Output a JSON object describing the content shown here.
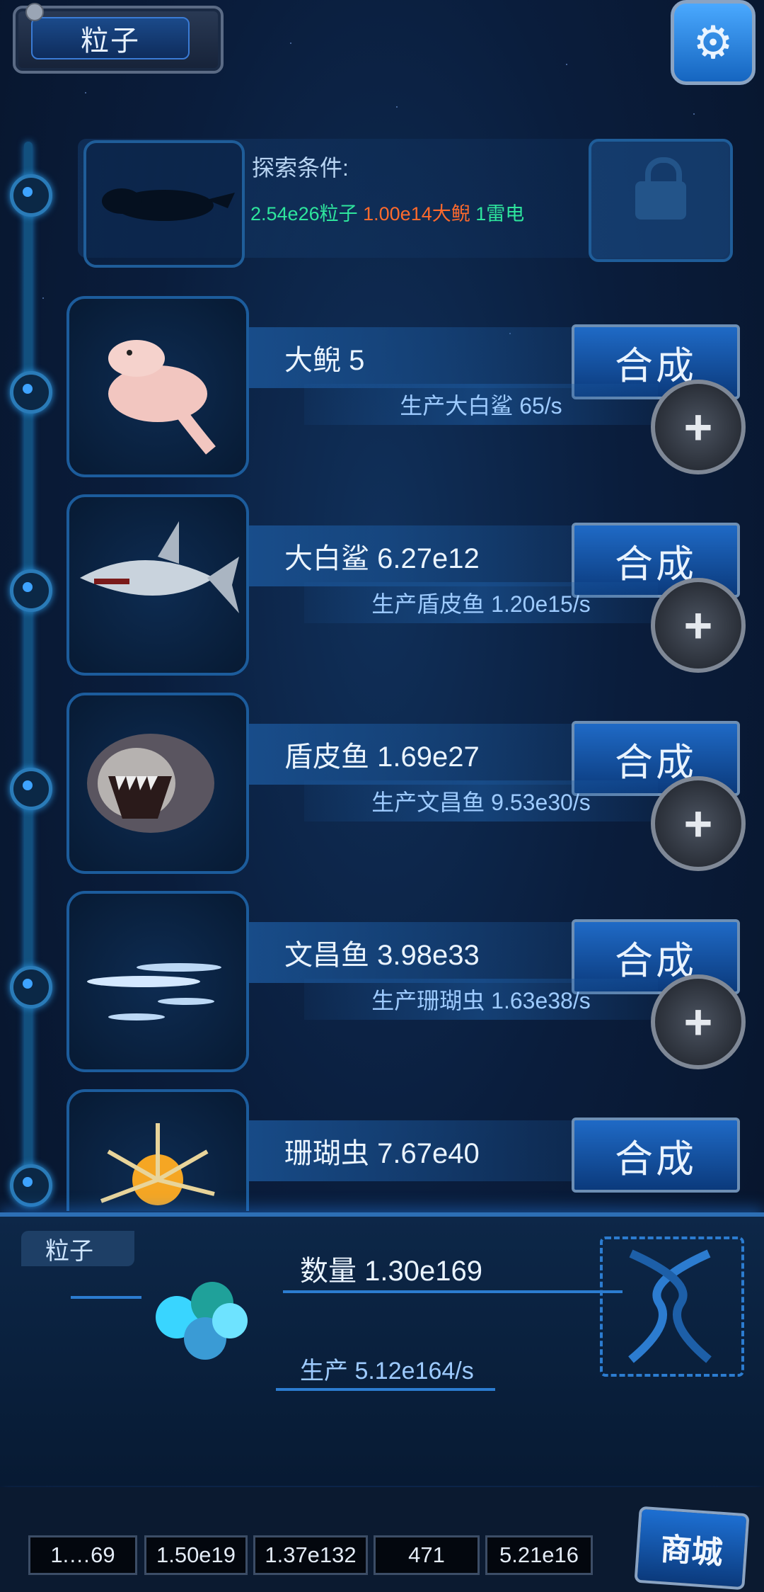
{
  "header": {
    "title": "粒子",
    "settings_icon": "gear-icon"
  },
  "locked": {
    "label": "探索条件:",
    "requirements": [
      {
        "text": "2.54e26粒子",
        "color": "#2ee59d"
      },
      {
        "text": "1.00e14大鲵",
        "color": "#ff6a2c"
      },
      {
        "text": "1雷电",
        "color": "#2ee59d"
      }
    ]
  },
  "creatures": [
    {
      "name": "大鲵 5",
      "synth_label": "合成",
      "production": "生产大白鲨 65/s"
    },
    {
      "name": "大白鲨 6.27e12",
      "synth_label": "合成",
      "production": "生产盾皮鱼 1.20e15/s"
    },
    {
      "name": "盾皮鱼 1.69e27",
      "synth_label": "合成",
      "production": "生产文昌鱼 9.53e30/s"
    },
    {
      "name": "文昌鱼 3.98e33",
      "synth_label": "合成",
      "production": "生产珊瑚虫 1.63e38/s"
    },
    {
      "name": "珊瑚虫 7.67e40",
      "synth_label": "合成",
      "production": ""
    }
  ],
  "panel": {
    "tag": "粒子",
    "count": "数量 1.30e169",
    "production": "生产 5.12e164/s"
  },
  "resources": [
    "1.…69",
    "1.50e19",
    "1.37e132",
    "471",
    "5.21e16"
  ],
  "shop_label": "商城"
}
